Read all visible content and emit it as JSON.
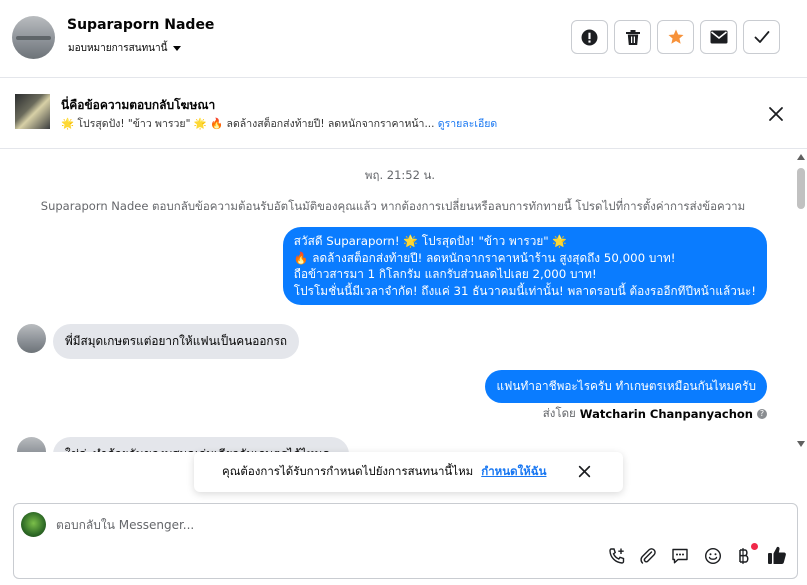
{
  "header": {
    "contact_name": "Suparaporn Nadee",
    "assign_label": "มอบหมายการสนทนานี้",
    "actions": [
      "mark-spam",
      "delete",
      "star",
      "mark-unread",
      "mark-done"
    ]
  },
  "ad_banner": {
    "title": "นี่คือข้อความตอบกลับโฆษณา",
    "preview": "🌟 โปรสุดปัง! \"ข้าว พารวย\" 🌟 🔥 ลดล้างสต็อกส่งท้ายปี! ลดหนักจากราคาหน้า...",
    "more_link": "ดูรายละเอียด"
  },
  "thread": {
    "timestamp": "พฤ. 21:52 น.",
    "system_note": "Suparaporn Nadee ตอบกลับข้อความต้อนรับอัตโนมัติของคุณแล้ว หากต้องการเปลี่ยนหรือลบการทักทายนี้ โปรดไปที่การตั้งค่าการส่งข้อความ",
    "outgoing_1": {
      "lines": [
        "สวัสดี Suparaporn! 🌟 โปรสุดปัง! \"ข้าว พารวย\" 🌟",
        "🔥 ลดล้างสต็อกส่งท้ายปี! ลดหนักจากราคาหน้าร้าน สูงสุดถึง 50,000 บาท!",
        "ถือข้าวสารมา 1 กิโลกรัม แลกรับส่วนลดไปเลย 2,000 บาท!",
        "โปรโมชั่นนี้มีเวลาจำกัด! ถึงแค่ 31 ธันวาคมนี้เท่านั้น! พลาดรอบนี้ ต้องรออีกทีปีหน้าแล้วนะ!"
      ]
    },
    "incoming_1": "พี่มีสมุดเกษตรแต่อยากให้แฟนเป็นคนออกรถ",
    "outgoing_2": "แฟนทำอาชีพอะไรครับ ทำเกษตรเหมือนกันไหมครับ",
    "sent_by_prefix": "ส่งโดย",
    "sent_by_name": "Watcharin Chanpanyachon",
    "incoming_2_partial": "ใช่ค่ะทำด้วยกันของบสมุดเล่มเดียวกันเกษตรได้ไหมคะ"
  },
  "toast": {
    "text": "คุณต้องการได้รับการกำหนดไปยังการสนทนานี้ไหม",
    "link": "กำหนดให้ฉัน"
  },
  "composer": {
    "placeholder": "ตอบกลับใน Messenger...",
    "tools": [
      "add-call-icon",
      "attachment-icon",
      "saved-replies-icon",
      "emoji-icon",
      "payment-icon",
      "like-icon"
    ]
  },
  "colors": {
    "outgoing_bubble": "#0a7cff",
    "incoming_bubble": "#e4e6eb",
    "link": "#1877f2",
    "star": "#f7923a"
  }
}
